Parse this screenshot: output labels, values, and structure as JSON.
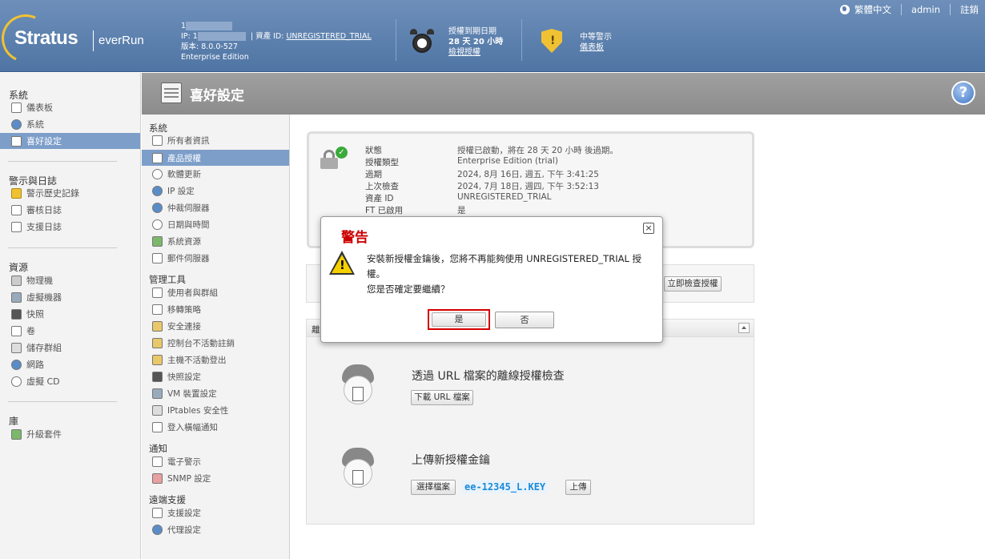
{
  "header": {
    "brand_main": "Stratus",
    "brand_product": "everRun",
    "host_prefix": "1",
    "ip_label": "IP: 1",
    "asset_label": "資產 ID:",
    "asset_id": "UNREGISTERED_TRIAL",
    "version": "版本: 8.0.0-527",
    "edition": "Enterprise Edition",
    "license_label": "授權到期日期",
    "license_remaining": "28 天 20 小時",
    "license_link": "檢視授權",
    "alarm_label": "中等警示",
    "alarm_link": "儀表板",
    "language": "繁體中文",
    "user": "admin",
    "logout": "註銷"
  },
  "leftnav": {
    "sections": [
      {
        "title": "系統",
        "items": [
          {
            "label": "儀表板",
            "icon": "info-icon"
          },
          {
            "label": "系統",
            "icon": "globe-icon"
          },
          {
            "label": "喜好設定",
            "icon": "preferences-icon",
            "active": true
          }
        ]
      },
      {
        "title": "警示與日誌",
        "items": [
          {
            "label": "警示歷史記錄",
            "icon": "bell-icon"
          },
          {
            "label": "審核日誌",
            "icon": "calendar-icon"
          },
          {
            "label": "支援日誌",
            "icon": "log-icon"
          }
        ]
      },
      {
        "title": "資源",
        "items": [
          {
            "label": "物理機",
            "icon": "server-icon"
          },
          {
            "label": "虛擬機器",
            "icon": "vm-icon"
          },
          {
            "label": "快照",
            "icon": "camera-icon"
          },
          {
            "label": "卷",
            "icon": "volume-icon"
          },
          {
            "label": "儲存群組",
            "icon": "storage-icon"
          },
          {
            "label": "網路",
            "icon": "network-icon"
          },
          {
            "label": "虛擬 CD",
            "icon": "cd-icon"
          }
        ]
      },
      {
        "title": "庫",
        "items": [
          {
            "label": "升級套件",
            "icon": "upgrade-icon"
          }
        ]
      }
    ]
  },
  "page": {
    "title": "喜好設定",
    "help": "?"
  },
  "subnav": {
    "sections": [
      {
        "title": "系統",
        "items": [
          {
            "label": "所有者資訊"
          },
          {
            "label": "產品授權",
            "active": true
          },
          {
            "label": "軟體更新"
          },
          {
            "label": "IP 設定"
          },
          {
            "label": "仲裁伺服器"
          },
          {
            "label": "日期與時間"
          },
          {
            "label": "系統資源"
          },
          {
            "label": "郵件伺服器"
          }
        ]
      },
      {
        "title": "管理工具",
        "items": [
          {
            "label": "使用者與群組"
          },
          {
            "label": "移轉策略"
          },
          {
            "label": "安全連接"
          },
          {
            "label": "控制台不活動註銷"
          },
          {
            "label": "主機不活動登出"
          },
          {
            "label": "快照設定"
          },
          {
            "label": "VM 裝置設定"
          },
          {
            "label": "IPtables 安全性"
          },
          {
            "label": "登入橫幅通知"
          }
        ]
      },
      {
        "title": "通知",
        "items": [
          {
            "label": "電子警示"
          },
          {
            "label": "SNMP 設定"
          }
        ]
      },
      {
        "title": "遠端支援",
        "items": [
          {
            "label": "支援設定"
          },
          {
            "label": "代理設定"
          }
        ]
      }
    ]
  },
  "license_status": {
    "rows": [
      {
        "label": "狀態",
        "value": "授權已啟動，將在 28 天 20 小時 後過期。"
      },
      {
        "label": "授權類型",
        "value": "Enterprise Edition (trial)"
      },
      {
        "label": "過期",
        "value": "2024, 8月 16日, 週五, 下午 3:41:25"
      },
      {
        "label": "上次檢查",
        "value": "2024, 7月 18日, 週四, 下午 3:52:13"
      },
      {
        "label": "資產 ID",
        "value": "UNREGISTERED_TRIAL"
      },
      {
        "label": "FT 已啟用",
        "value": "是"
      }
    ],
    "check_now": "立即檢查授權"
  },
  "offline": {
    "header": "離",
    "url_title": "透過 URL 檔案的離線授權檢查",
    "url_download": "下載 URL 檔案",
    "upload_title": "上傳新授權金鑰",
    "choose_file": "選擇檔案",
    "file_name": "ee-12345_L.KEY",
    "upload": "上傳"
  },
  "dialog": {
    "title": "警告",
    "close": "×",
    "message_line1": "安裝新授權金鑰後，您將不再能夠使用 UNREGISTERED_TRIAL 授權。",
    "message_line2": "您是否確定要繼續？",
    "yes": "是",
    "no": "否"
  },
  "colors": {
    "header_blue": "#5b7fae",
    "active_nav": "#7c9ec9",
    "dialog_title": "#cc0000",
    "file_name": "#1a8ad8"
  }
}
